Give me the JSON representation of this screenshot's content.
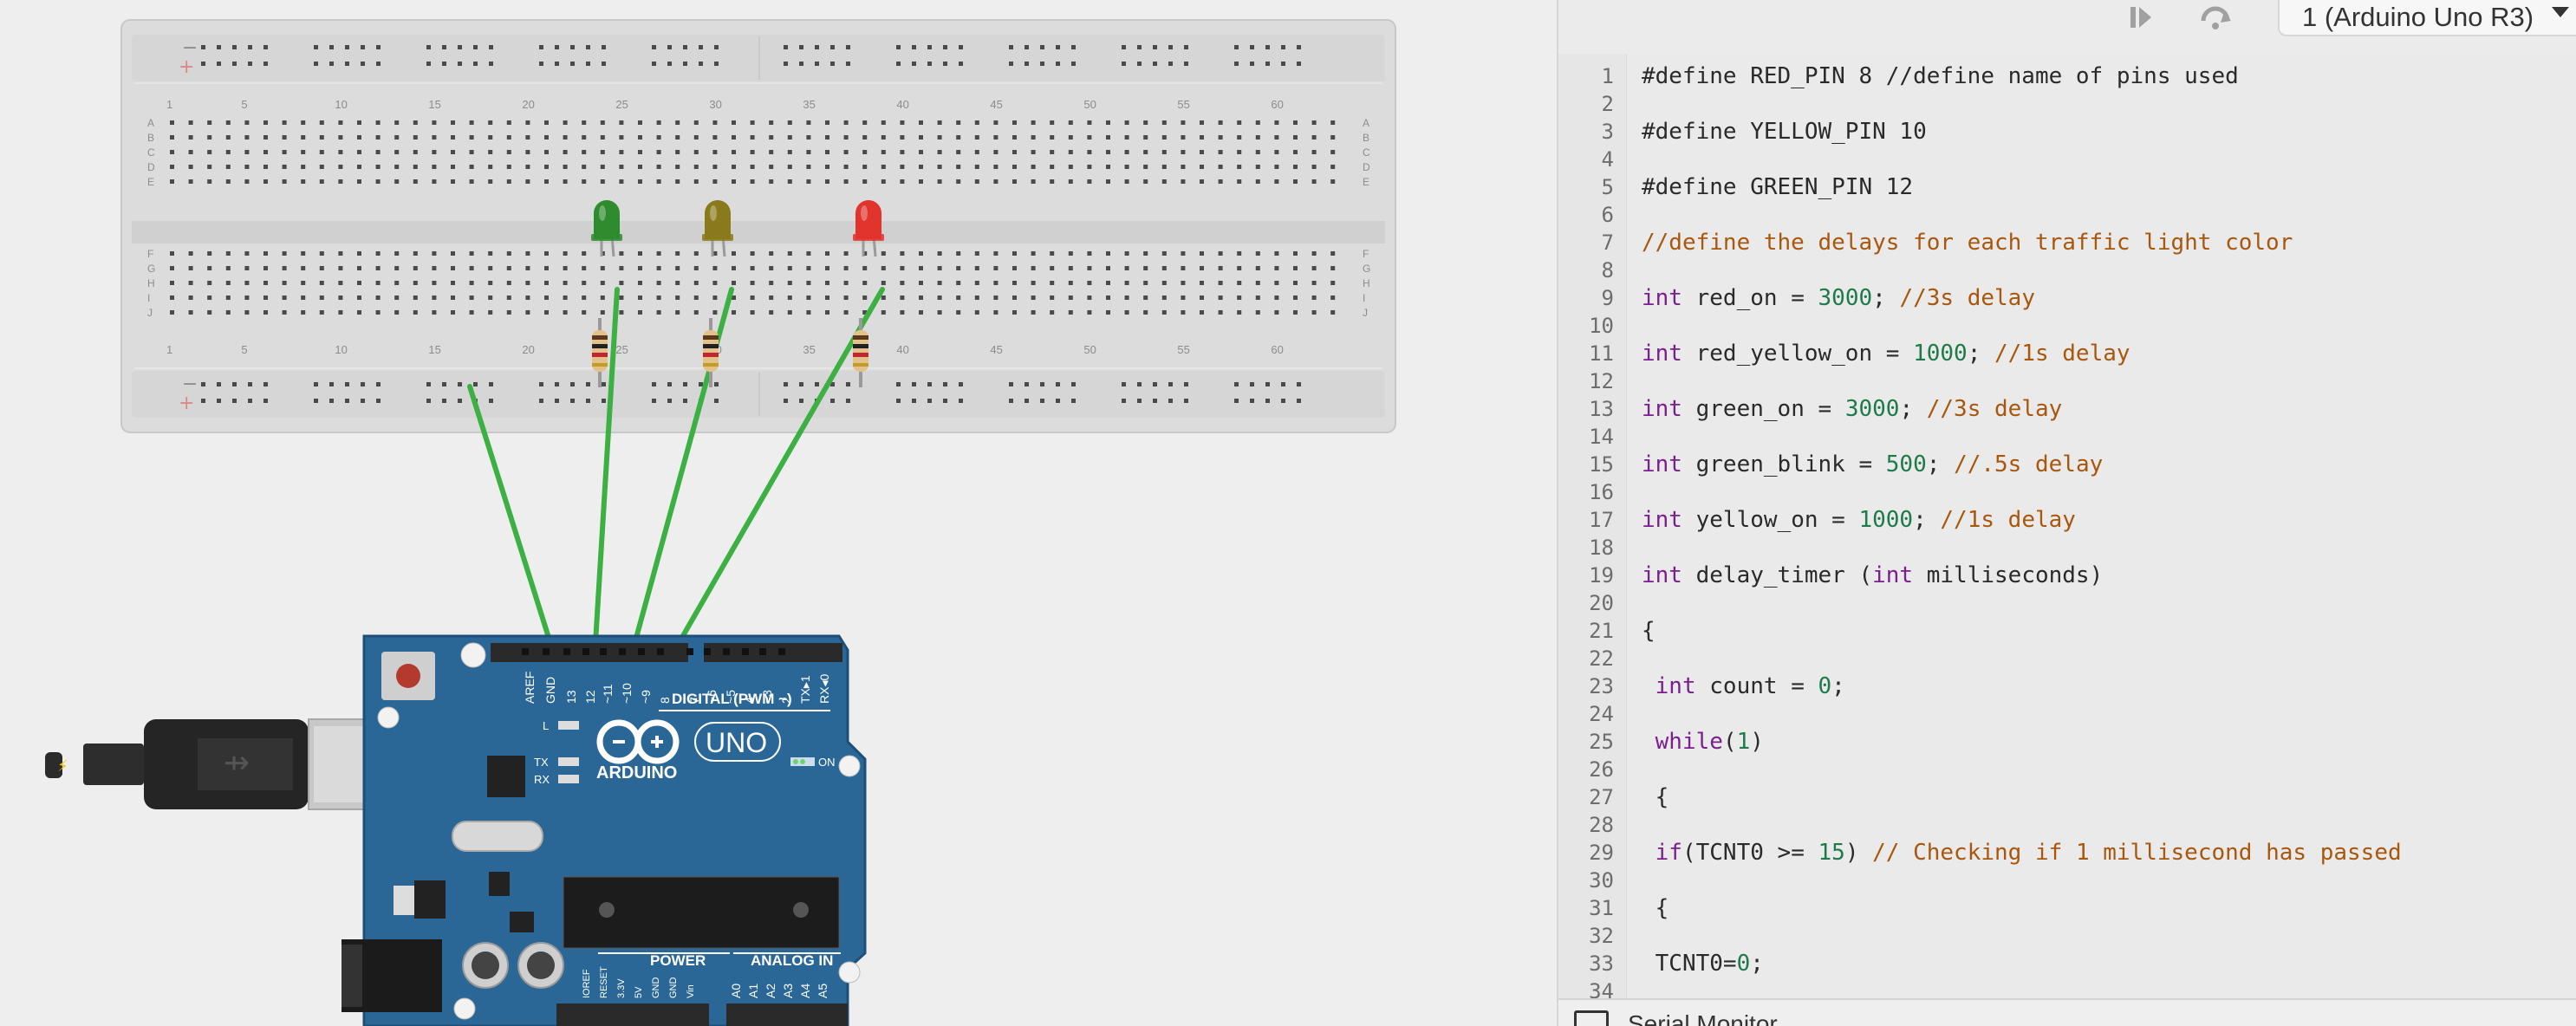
{
  "toolbar": {
    "upload_icon": "upload-run-icon",
    "step_icon": "step-over-icon",
    "board_select": "1 (Arduino Uno R3)"
  },
  "breadboard": {
    "column_numbers": [
      "1",
      "5",
      "10",
      "15",
      "20",
      "25",
      "30",
      "35",
      "40",
      "45",
      "50",
      "55",
      "60"
    ],
    "row_letters_top": [
      "A",
      "B",
      "C",
      "D",
      "E"
    ],
    "row_letters_bottom": [
      "F",
      "G",
      "H",
      "I",
      "J"
    ],
    "rail_minus": "−",
    "rail_plus": "+"
  },
  "components": {
    "leds": [
      {
        "name": "green-led",
        "color": "#2e8b2e"
      },
      {
        "name": "yellow-led",
        "color": "#8a7a1c"
      },
      {
        "name": "red-led",
        "color": "#e0342c"
      }
    ],
    "wire_color": "#3cb043"
  },
  "arduino": {
    "brand": "ARDUINO",
    "model": "UNO",
    "digital_label": "DIGITAL (PWM ~)",
    "power_label": "POWER",
    "analog_label": "ANALOG IN",
    "on_label": "ON",
    "l_label": "L",
    "tx_label": "TX",
    "rx_label": "RX",
    "digital_pins": [
      "AREF",
      "GND",
      "13",
      "12",
      "~11",
      "~10",
      "~9",
      "8",
      "7",
      "~6",
      "~5",
      "4",
      "~3",
      "2",
      "TX▸1",
      "RX◂0"
    ],
    "power_pins": [
      "IOREF",
      "RESET",
      "3.3V",
      "5V",
      "GND",
      "GND",
      "Vin"
    ],
    "analog_pins": [
      "A0",
      "A1",
      "A2",
      "A3",
      "A4",
      "A5"
    ]
  },
  "editor": {
    "lines": [
      {
        "n": "1",
        "segs": [
          {
            "t": "#define RED_PIN 8 //define name of pins used",
            "c": ""
          }
        ]
      },
      {
        "n": "2",
        "segs": []
      },
      {
        "n": "3",
        "segs": [
          {
            "t": "#define YELLOW_PIN 10",
            "c": ""
          }
        ]
      },
      {
        "n": "4",
        "segs": []
      },
      {
        "n": "5",
        "segs": [
          {
            "t": "#define GREEN_PIN 12",
            "c": ""
          }
        ]
      },
      {
        "n": "6",
        "segs": []
      },
      {
        "n": "7",
        "segs": [
          {
            "t": "//define the delays for each traffic light color",
            "c": "cm"
          }
        ]
      },
      {
        "n": "8",
        "segs": []
      },
      {
        "n": "9",
        "segs": [
          {
            "t": "int",
            "c": "kw"
          },
          {
            "t": " red_on = ",
            "c": ""
          },
          {
            "t": "3000",
            "c": "num"
          },
          {
            "t": "; ",
            "c": ""
          },
          {
            "t": "//3s delay",
            "c": "cm"
          }
        ]
      },
      {
        "n": "10",
        "segs": []
      },
      {
        "n": "11",
        "segs": [
          {
            "t": "int",
            "c": "kw"
          },
          {
            "t": " red_yellow_on = ",
            "c": ""
          },
          {
            "t": "1000",
            "c": "num"
          },
          {
            "t": "; ",
            "c": ""
          },
          {
            "t": "//1s delay",
            "c": "cm"
          }
        ]
      },
      {
        "n": "12",
        "segs": []
      },
      {
        "n": "13",
        "segs": [
          {
            "t": "int",
            "c": "kw"
          },
          {
            "t": " green_on = ",
            "c": ""
          },
          {
            "t": "3000",
            "c": "num"
          },
          {
            "t": "; ",
            "c": ""
          },
          {
            "t": "//3s delay",
            "c": "cm"
          }
        ]
      },
      {
        "n": "14",
        "segs": []
      },
      {
        "n": "15",
        "segs": [
          {
            "t": "int",
            "c": "kw"
          },
          {
            "t": " green_blink = ",
            "c": ""
          },
          {
            "t": "500",
            "c": "num"
          },
          {
            "t": "; ",
            "c": ""
          },
          {
            "t": "//.5s delay",
            "c": "cm"
          }
        ]
      },
      {
        "n": "16",
        "segs": []
      },
      {
        "n": "17",
        "segs": [
          {
            "t": "int",
            "c": "kw"
          },
          {
            "t": " yellow_on = ",
            "c": ""
          },
          {
            "t": "1000",
            "c": "num"
          },
          {
            "t": "; ",
            "c": ""
          },
          {
            "t": "//1s delay",
            "c": "cm"
          }
        ]
      },
      {
        "n": "18",
        "segs": []
      },
      {
        "n": "19",
        "segs": [
          {
            "t": "int",
            "c": "kw"
          },
          {
            "t": " delay_timer (",
            "c": ""
          },
          {
            "t": "int",
            "c": "kw"
          },
          {
            "t": " milliseconds)",
            "c": ""
          }
        ]
      },
      {
        "n": "20",
        "segs": []
      },
      {
        "n": "21",
        "segs": [
          {
            "t": "{",
            "c": ""
          }
        ]
      },
      {
        "n": "22",
        "segs": []
      },
      {
        "n": "23",
        "segs": [
          {
            "t": " ",
            "c": ""
          },
          {
            "t": "int",
            "c": "kw"
          },
          {
            "t": " count = ",
            "c": ""
          },
          {
            "t": "0",
            "c": "num"
          },
          {
            "t": ";",
            "c": ""
          }
        ]
      },
      {
        "n": "24",
        "segs": []
      },
      {
        "n": "25",
        "segs": [
          {
            "t": " ",
            "c": ""
          },
          {
            "t": "while",
            "c": "kw"
          },
          {
            "t": "(",
            "c": ""
          },
          {
            "t": "1",
            "c": "num"
          },
          {
            "t": ")",
            "c": ""
          }
        ]
      },
      {
        "n": "26",
        "segs": []
      },
      {
        "n": "27",
        "segs": [
          {
            "t": " {",
            "c": ""
          }
        ]
      },
      {
        "n": "28",
        "segs": []
      },
      {
        "n": "29",
        "segs": [
          {
            "t": " ",
            "c": ""
          },
          {
            "t": "if",
            "c": "kw"
          },
          {
            "t": "(TCNT0 >= ",
            "c": ""
          },
          {
            "t": "15",
            "c": "num"
          },
          {
            "t": ") ",
            "c": ""
          },
          {
            "t": "// Checking if 1 millisecond has passed",
            "c": "cm"
          }
        ]
      },
      {
        "n": "30",
        "segs": []
      },
      {
        "n": "31",
        "segs": [
          {
            "t": " {",
            "c": ""
          }
        ]
      },
      {
        "n": "32",
        "segs": []
      },
      {
        "n": "33",
        "segs": [
          {
            "t": " TCNT0=",
            "c": ""
          },
          {
            "t": "0",
            "c": "num"
          },
          {
            "t": ";",
            "c": ""
          }
        ]
      },
      {
        "n": "34",
        "segs": []
      }
    ]
  },
  "serial_monitor": {
    "label": "Serial Monitor",
    "icon": "serial-monitor-icon"
  }
}
